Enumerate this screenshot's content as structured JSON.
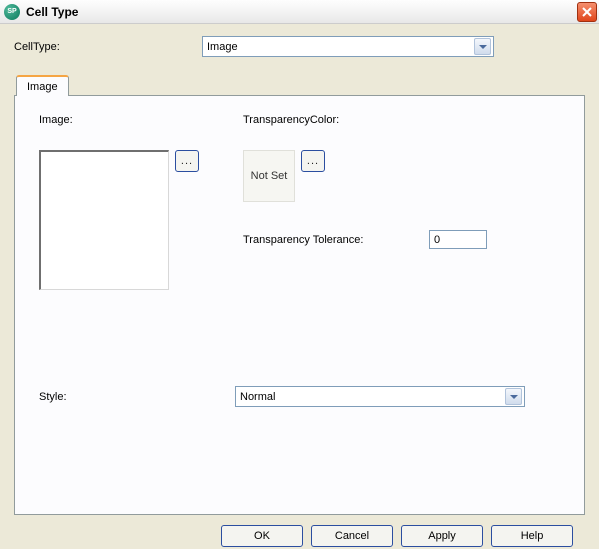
{
  "window": {
    "title": "Cell Type",
    "icon_letters": "SP"
  },
  "form": {
    "celltype_label": "CellType:",
    "celltype_value": "Image"
  },
  "tab": {
    "label": "Image"
  },
  "imageSection": {
    "label": "Image:",
    "browse": "..."
  },
  "transparencySection": {
    "label": "TransparencyColor:",
    "swatch_text": "Not Set",
    "browse": "..."
  },
  "tolerance": {
    "label": "Transparency Tolerance:",
    "value": "0"
  },
  "style": {
    "label": "Style:",
    "value": "Normal"
  },
  "buttons": {
    "ok": "OK",
    "cancel": "Cancel",
    "apply": "Apply",
    "help": "Help"
  }
}
